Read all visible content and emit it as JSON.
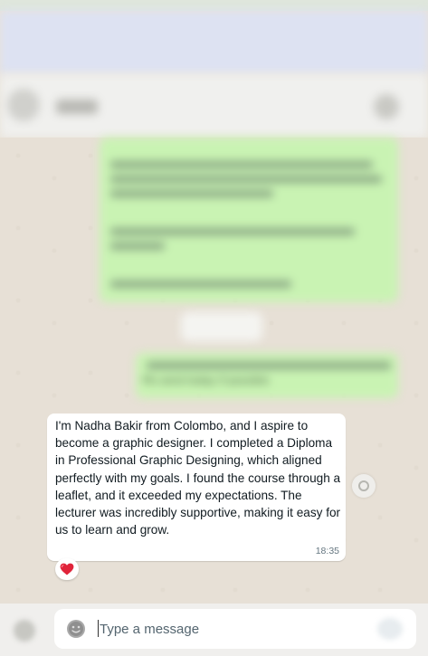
{
  "chat": {
    "outgoing_blurred_note": "Pls send today if possible",
    "incoming_message": {
      "text": "I'm Nadha Bakir from Colombo, and I aspire to become a graphic designer. I completed a Diploma in Professional Graphic Designing, which aligned perfectly with my goals. I found the course through a leaflet, and it exceeded my expectations. The lecturer was incredibly supportive, making it easy for us to learn and grow.",
      "time": "18:35",
      "reaction": "❤️"
    }
  },
  "composer": {
    "placeholder": "Type a message"
  },
  "colors": {
    "outgoing_bubble": "#c9f3b3",
    "incoming_bubble": "#ffffff",
    "chat_background": "#e7e0d6",
    "heart": "#e0243a"
  },
  "icons": {
    "emoji": "emoji-icon",
    "reaction": "heart-icon",
    "forward": "forward-icon",
    "attach": "attach-icon",
    "mic": "mic-icon"
  }
}
